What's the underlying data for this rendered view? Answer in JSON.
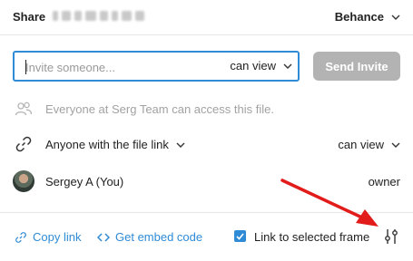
{
  "header": {
    "title": "Share",
    "team": "Behance"
  },
  "invite": {
    "placeholder": "Invite someone...",
    "permission": "can view",
    "send_label": "Send Invite"
  },
  "access": {
    "everyone_text": "Everyone at Serg Team can access this file."
  },
  "link_access": {
    "label": "Anyone with the file link",
    "permission": "can view"
  },
  "members": [
    {
      "name": "Sergey A (You)",
      "role": "owner"
    }
  ],
  "footer": {
    "copy_link": "Copy link",
    "embed_code": "Get embed code",
    "link_to_frame": "Link to selected frame",
    "link_to_frame_checked": true
  },
  "colors": {
    "accent": "#2f8bd6",
    "send_disabled": "#b3b3b3",
    "annotation_arrow": "#e21b1b"
  },
  "icons": [
    "chevron-down-icon",
    "people-icon",
    "link-icon",
    "copy-link-icon",
    "code-icon",
    "checkbox-check-icon",
    "settings-sliders-icon"
  ]
}
